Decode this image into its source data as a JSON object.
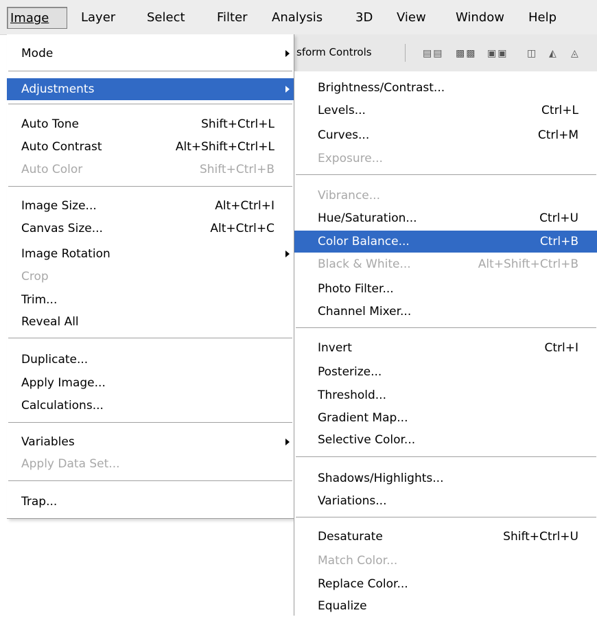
{
  "menubar": [
    {
      "label": "Image",
      "active": true
    },
    {
      "label": "Layer"
    },
    {
      "label": "Select"
    },
    {
      "label": "Filter"
    },
    {
      "label": "Analysis"
    },
    {
      "label": "3D"
    },
    {
      "label": "View"
    },
    {
      "label": "Window"
    },
    {
      "label": "Help"
    }
  ],
  "toolbar": {
    "label": "sform Controls"
  },
  "image_menu": [
    {
      "label": "Mode",
      "submenu": true
    },
    {
      "label": "Adjustments",
      "submenu": true,
      "highlighted": true
    },
    {
      "label": "Auto Tone",
      "shortcut": "Shift+Ctrl+L"
    },
    {
      "label": "Auto Contrast",
      "shortcut": "Alt+Shift+Ctrl+L"
    },
    {
      "label": "Auto Color",
      "shortcut": "Shift+Ctrl+B",
      "disabled": true
    },
    {
      "label": "Image Size...",
      "shortcut": "Alt+Ctrl+I"
    },
    {
      "label": "Canvas Size...",
      "shortcut": "Alt+Ctrl+C"
    },
    {
      "label": "Image Rotation",
      "submenu": true
    },
    {
      "label": "Crop",
      "disabled": true
    },
    {
      "label": "Trim..."
    },
    {
      "label": "Reveal All"
    },
    {
      "label": "Duplicate..."
    },
    {
      "label": "Apply Image..."
    },
    {
      "label": "Calculations..."
    },
    {
      "label": "Variables",
      "submenu": true
    },
    {
      "label": "Apply Data Set...",
      "disabled": true
    },
    {
      "label": "Trap..."
    }
  ],
  "adjustments_menu": [
    {
      "label": "Brightness/Contrast..."
    },
    {
      "label": "Levels...",
      "shortcut": "Ctrl+L"
    },
    {
      "label": "Curves...",
      "shortcut": "Ctrl+M"
    },
    {
      "label": "Exposure...",
      "disabled": true
    },
    {
      "label": "Vibrance...",
      "disabled": true
    },
    {
      "label": "Hue/Saturation...",
      "shortcut": "Ctrl+U"
    },
    {
      "label": "Color Balance...",
      "shortcut": "Ctrl+B",
      "highlighted": true
    },
    {
      "label": "Black & White...",
      "shortcut": "Alt+Shift+Ctrl+B",
      "disabled": true
    },
    {
      "label": "Photo Filter..."
    },
    {
      "label": "Channel Mixer..."
    },
    {
      "label": "Invert",
      "shortcut": "Ctrl+I"
    },
    {
      "label": "Posterize..."
    },
    {
      "label": "Threshold..."
    },
    {
      "label": "Gradient Map..."
    },
    {
      "label": "Selective Color..."
    },
    {
      "label": "Shadows/Highlights..."
    },
    {
      "label": "Variations..."
    },
    {
      "label": "Desaturate",
      "shortcut": "Shift+Ctrl+U"
    },
    {
      "label": "Match Color...",
      "disabled": true
    },
    {
      "label": "Replace Color..."
    },
    {
      "label": "Equalize"
    }
  ],
  "colors": {
    "highlight": "#316ac5",
    "disabled": "#a8a8a8"
  }
}
